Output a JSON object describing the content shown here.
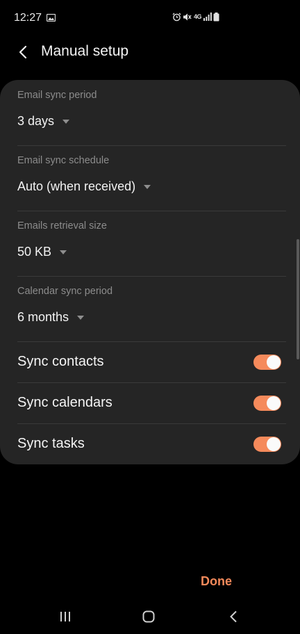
{
  "status": {
    "time": "12:27",
    "network": "4G"
  },
  "header": {
    "title": "Manual setup"
  },
  "settings": [
    {
      "label": "Email sync period",
      "value": "3 days"
    },
    {
      "label": "Email sync schedule",
      "value": "Auto (when received)"
    },
    {
      "label": "Emails retrieval size",
      "value": "50 KB"
    },
    {
      "label": "Calendar sync period",
      "value": "6 months"
    }
  ],
  "toggles": [
    {
      "label": "Sync contacts",
      "on": true
    },
    {
      "label": "Sync calendars",
      "on": true
    },
    {
      "label": "Sync tasks",
      "on": true
    }
  ],
  "footer": {
    "done_label": "Done"
  },
  "colors": {
    "accent": "#f58a5b",
    "background": "#000000",
    "card": "#252525"
  }
}
